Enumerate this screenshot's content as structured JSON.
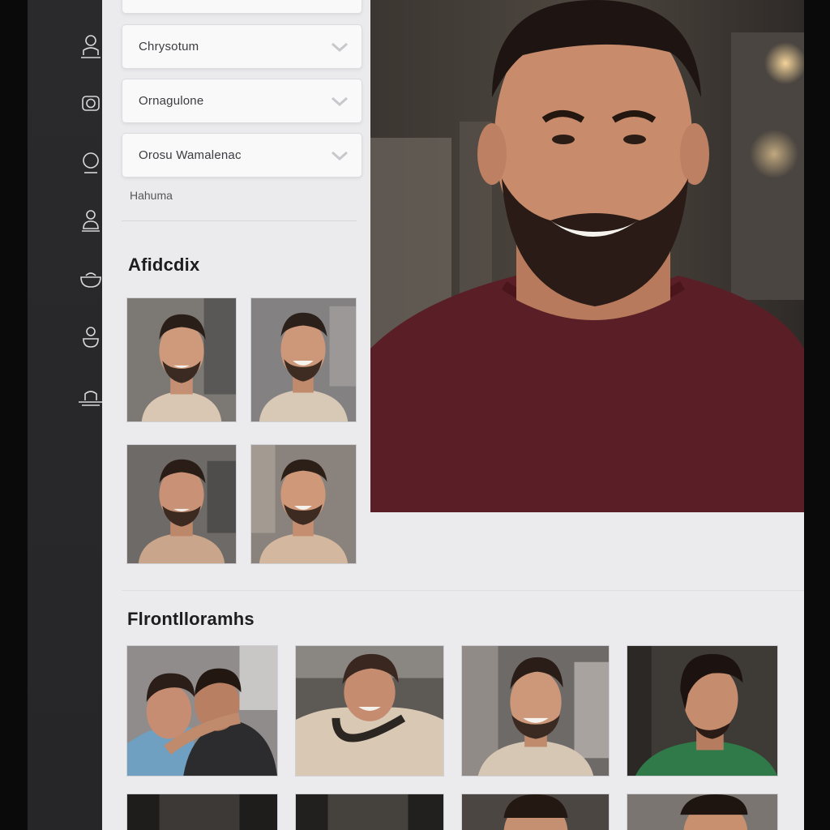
{
  "sidebar": {
    "icons": [
      {
        "name": "profile-icon"
      },
      {
        "name": "camera-icon"
      },
      {
        "name": "circle-icon"
      },
      {
        "name": "person-icon"
      },
      {
        "name": "bowl-icon"
      },
      {
        "name": "face-icon"
      },
      {
        "name": "hat-icon"
      }
    ]
  },
  "filters": {
    "dropdowns": [
      {
        "label": "Chrysotum"
      },
      {
        "label": "Ornagulone"
      },
      {
        "label": "Orosu Wamalenac"
      }
    ],
    "link": "Hahuma"
  },
  "sections": {
    "selected_title": "Afidcdix",
    "recommended_title": "Flrontlloramhs"
  },
  "thumbs_small": [
    {
      "subject": "bearded man smiling, beige tank"
    },
    {
      "subject": "man laughing, beige shirt"
    },
    {
      "subject": "man smiling, beige shirt"
    },
    {
      "subject": "man smiling, beige tee"
    }
  ],
  "thumbs_bottom": [
    {
      "subject": "two men embracing"
    },
    {
      "subject": "man in white tank"
    },
    {
      "subject": "man smiling, beige shirt"
    },
    {
      "subject": "man in profile, green shirt"
    }
  ],
  "hero": {
    "subject": "smiling bearded man in maroon t-shirt"
  },
  "colors": {
    "rail": "#27272a",
    "content": "#ebebed",
    "hero_shirt": "#5a1f26"
  }
}
